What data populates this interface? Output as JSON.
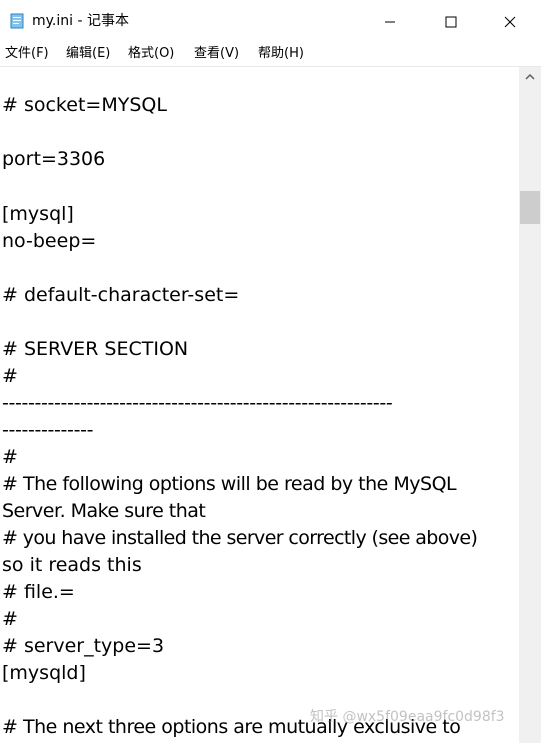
{
  "window": {
    "title": "my.ini - 记事本",
    "icon": "notepad-icon"
  },
  "controls": {
    "minimize_icon": "minimize-icon",
    "maximize_icon": "maximize-icon",
    "close_icon": "close-icon"
  },
  "menu": [
    {
      "label": "文件(F)"
    },
    {
      "label": "编辑(E)"
    },
    {
      "label": "格式(O)"
    },
    {
      "label": "查看(V)"
    },
    {
      "label": "帮助(H)"
    }
  ],
  "editor": {
    "lines": [
      "# socket=MYSQL",
      "port=3306",
      "[mysql]",
      "no-beep=",
      "# default-character-set=",
      "# SERVER SECTION",
      "#",
      "------------------------------------------------------------",
      "--------------",
      "#",
      "# The following options will be read by the MySQL",
      "Server. Make sure that",
      "# you have installed the server correctly (see above)",
      "so it reads this",
      "# file.=",
      "#",
      "# server_type=3",
      "[mysqld]",
      "# The next three options are mutually exclusive to"
    ]
  },
  "scrollbar": {
    "up_icon": "scroll-up-arrow-icon"
  },
  "watermark": "知乎 @wx5f09eaa9fc0d98f3"
}
